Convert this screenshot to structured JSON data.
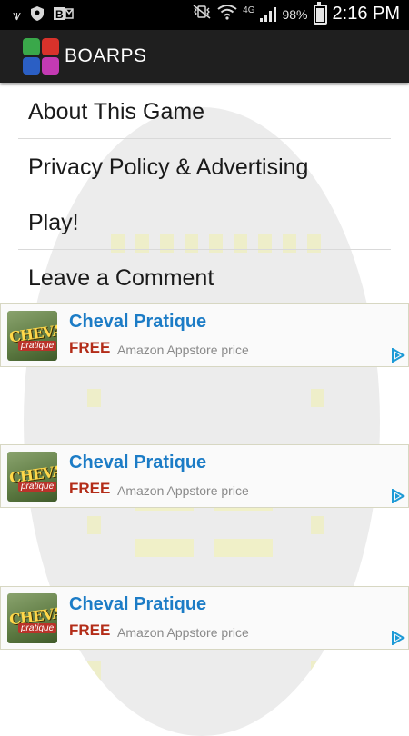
{
  "status_bar": {
    "icons_left": [
      "usb-icon",
      "shield-icon",
      "b-notification-icon"
    ],
    "network_label": "4G",
    "battery_percent": "98%",
    "time": "2:16 PM"
  },
  "action_bar": {
    "title": "BOARPS"
  },
  "menu": {
    "items": [
      {
        "label": "About This Game"
      },
      {
        "label": "Privacy Policy & Advertising"
      },
      {
        "label": "Play!"
      },
      {
        "label": "Leave a Comment"
      }
    ]
  },
  "ads": [
    {
      "logo_line1": "CHEVAL",
      "logo_line2": "pratique",
      "title": "Cheval Pratique",
      "badge": "FREE",
      "price_text": "Amazon Appstore price"
    },
    {
      "logo_line1": "CHEVAL",
      "logo_line2": "pratique",
      "title": "Cheval Pratique",
      "badge": "FREE",
      "price_text": "Amazon Appstore price"
    },
    {
      "logo_line1": "CHEVAL",
      "logo_line2": "pratique",
      "title": "Cheval Pratique",
      "badge": "FREE",
      "price_text": "Amazon Appstore price"
    }
  ],
  "colors": {
    "action_bar_bg": "#1f1f1f",
    "ad_title": "#1c7cc6",
    "ad_free": "#b32c18",
    "ad_arrow": "#1c9ad6"
  }
}
